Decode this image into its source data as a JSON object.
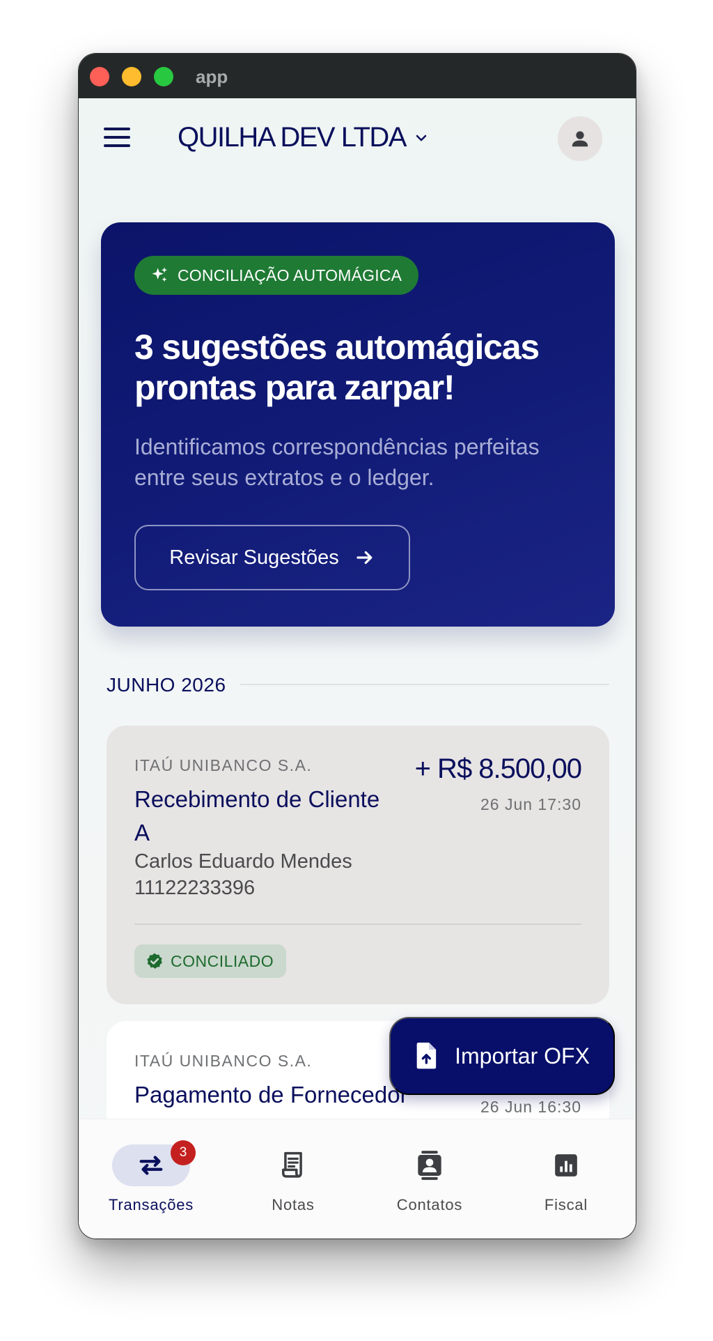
{
  "window": {
    "title": "app"
  },
  "header": {
    "company_name": "QUILHA DEV LTDA"
  },
  "hero": {
    "badge": "CONCILIAÇÃO AUTOMÁGICA",
    "headline": "3 sugestões automágicas prontas para zarpar!",
    "subtext": "Identificamos correspondências perfeitas entre seus extratos e o ledger.",
    "cta_label": "Revisar Sugestões"
  },
  "section": {
    "month_label": "JUNHO 2026"
  },
  "transactions": [
    {
      "bank": "ITAÚ UNIBANCO S.A.",
      "title": "Recebimento de Cliente A",
      "amount": "+ R$ 8.500,00",
      "time": "26 Jun 17:30",
      "person_name": "Carlos Eduardo Mendes",
      "person_doc": "11122233396",
      "status": "CONCILIADO"
    },
    {
      "bank": "ITAÚ UNIBANCO S.A.",
      "title": "Pagamento de Fornecedor",
      "time": "26 Jun 16:30"
    }
  ],
  "fab": {
    "label": "Importar OFX"
  },
  "nav": {
    "items": [
      {
        "label": "Transações",
        "badge": "3",
        "icon": "swap-arrows-icon"
      },
      {
        "label": "Notas",
        "icon": "receipt-icon"
      },
      {
        "label": "Contatos",
        "icon": "contact-card-icon"
      },
      {
        "label": "Fiscal",
        "icon": "bar-chart-icon"
      }
    ]
  },
  "colors": {
    "brand_navy": "#0a0f5c",
    "hero_bg": "#0b1469",
    "success_green": "#1f7a34",
    "badge_red": "#c42020"
  }
}
